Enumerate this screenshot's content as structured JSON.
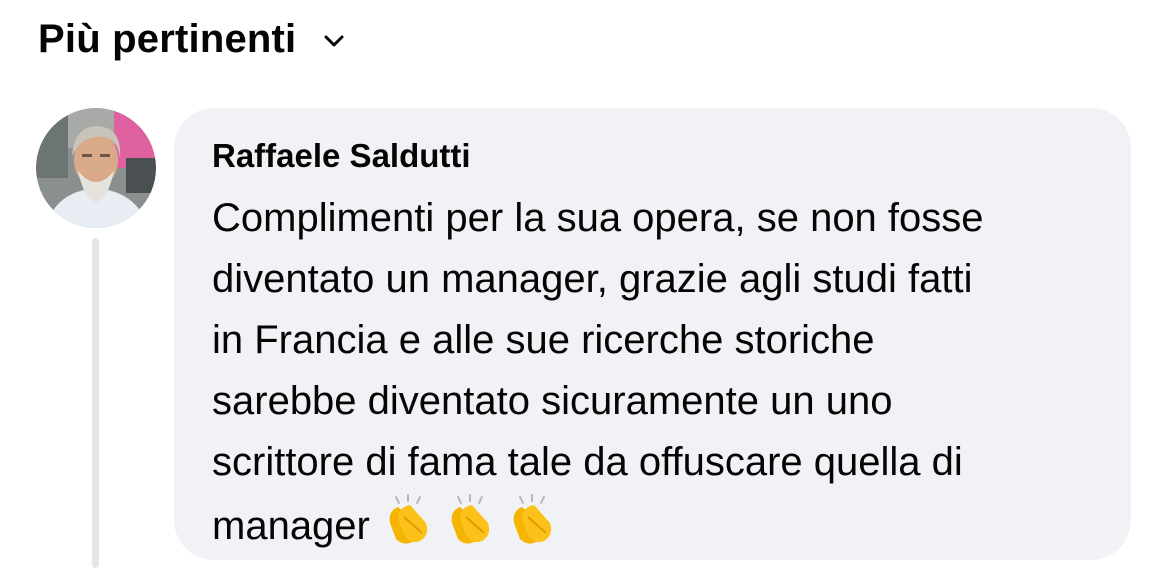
{
  "sort": {
    "label": "Più pertinenti",
    "icon": "chevron-down-icon"
  },
  "comment": {
    "avatar_icon": "profile-photo",
    "author": "Raffaele Saldutti",
    "text": "Complimenti per la sua opera, se non fosse\ndiventato un manager, grazie agli studi fatti\nin Francia e alle sue ricerche storiche\nsarebbe diventato sicuramente un uno\nscrittore di fama tale da offuscare quella di\nmanager",
    "emojis": [
      "clapping-hands",
      "clapping-hands",
      "clapping-hands"
    ]
  },
  "colors": {
    "bubble_bg": "#f0f2f5",
    "thread_line": "#e4e6eb",
    "text": "#050505"
  }
}
